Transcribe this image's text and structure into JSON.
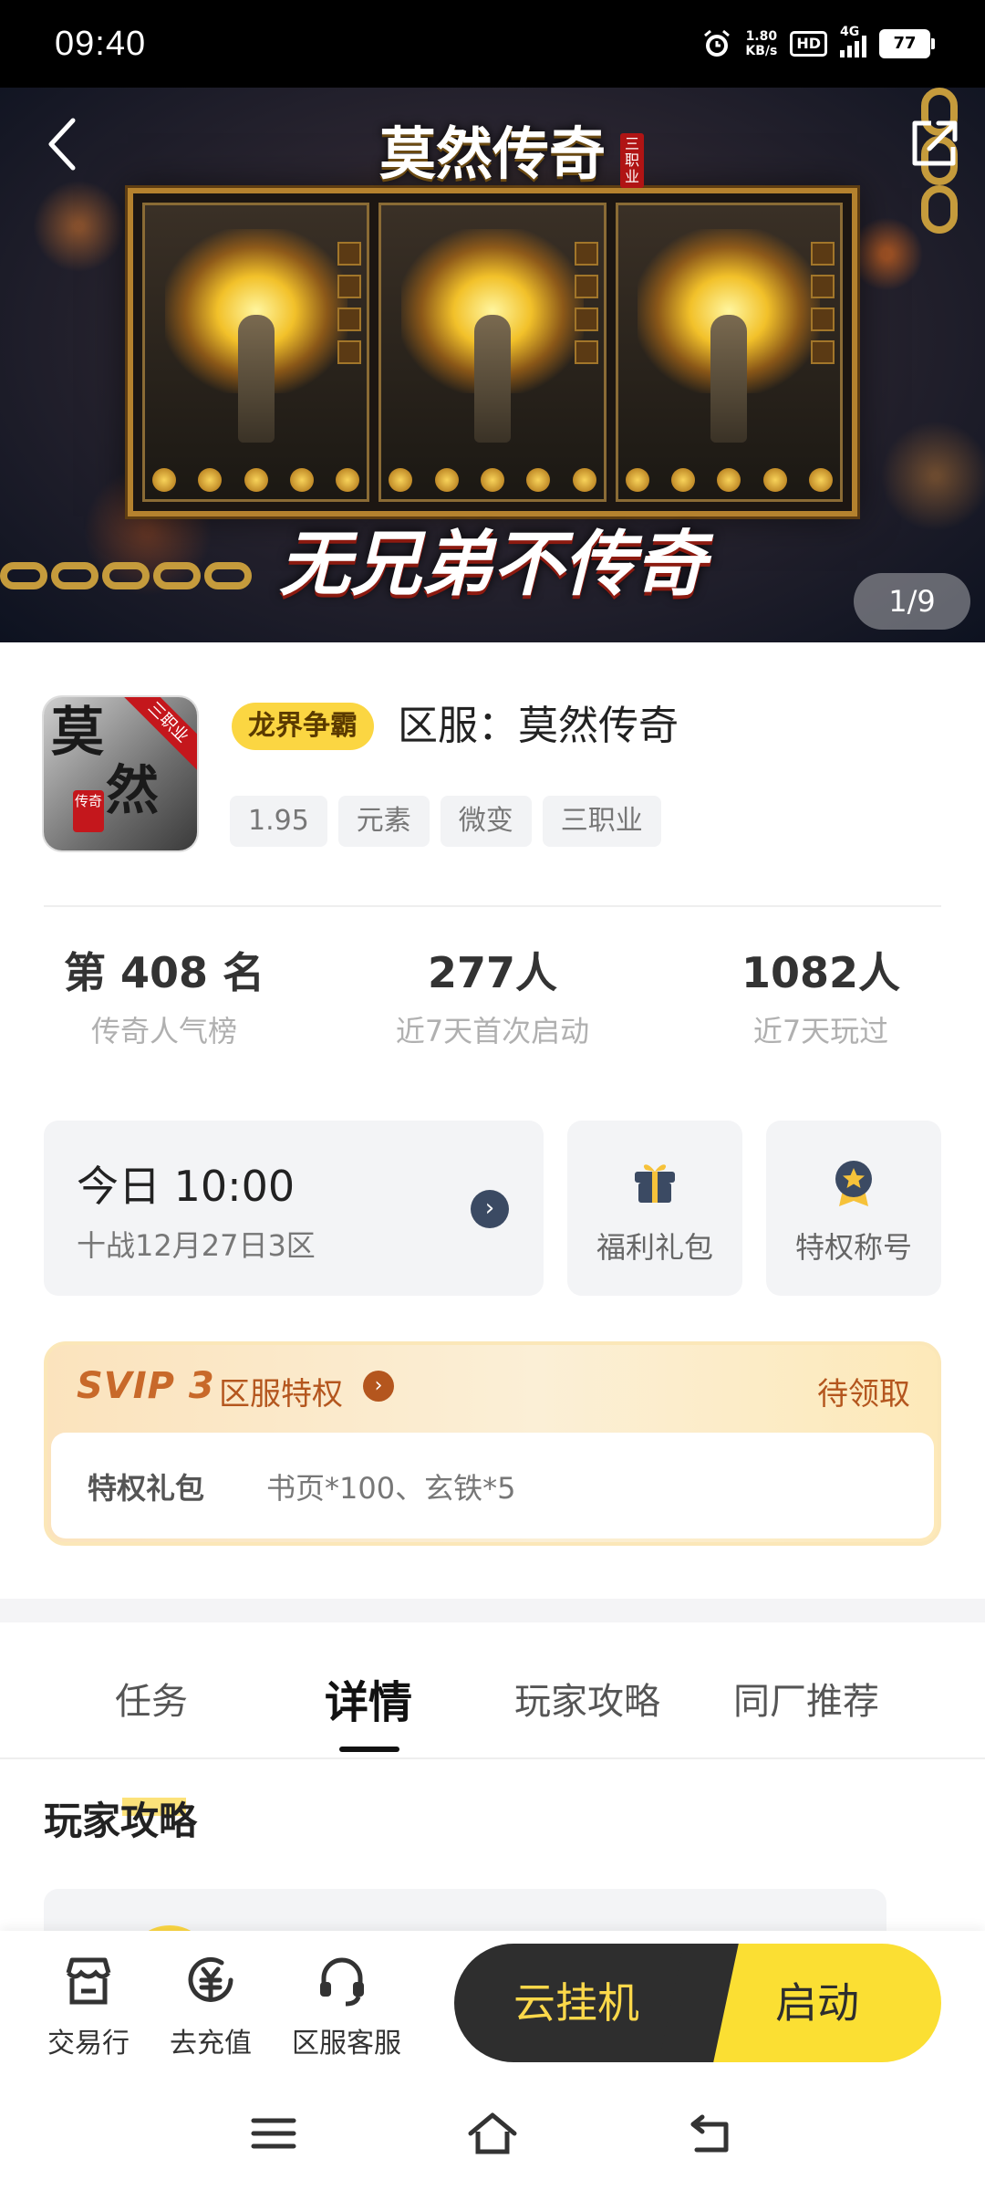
{
  "status_bar": {
    "time": "09:40",
    "net_speed_value": "1.80",
    "net_speed_unit": "KB/s",
    "hd_label": "HD",
    "network_type": "4G",
    "battery": "77",
    "icons": [
      "alarm-icon",
      "hd-icon",
      "signal-icon",
      "battery-icon"
    ]
  },
  "hero": {
    "title": "莫然传奇",
    "title_badge": "三职业",
    "slogan": "无兄弟不传奇",
    "page_indicator": "1/9",
    "icons": [
      "back-arrow-icon",
      "share-icon"
    ]
  },
  "game": {
    "icon_text_1": "莫",
    "icon_text_2": "然",
    "icon_ribbon": "三职业",
    "icon_stamp": "传奇",
    "badge": "龙界争霸",
    "title": "区服：莫然传奇",
    "tags": [
      "1.95",
      "元素",
      "微变",
      "三职业"
    ]
  },
  "stats": [
    {
      "value": "第 408 名",
      "label": "传奇人气榜"
    },
    {
      "value": "277人",
      "label": "近7天首次启动"
    },
    {
      "value": "1082人",
      "label": "近7天玩过"
    }
  ],
  "server_open": {
    "time": "今日 10:00",
    "server": "十战12月27日3区"
  },
  "quick_actions": [
    {
      "label": "福利礼包",
      "icon": "gift-box-icon"
    },
    {
      "label": "特权称号",
      "icon": "star-medal-icon"
    }
  ],
  "svip": {
    "logo": "SVIP 3",
    "name": "区服特权",
    "status": "待领取",
    "gift_key": "特权礼包",
    "gift_value": "书页*100、玄铁*5"
  },
  "tabs": [
    {
      "label": "任务",
      "active": false
    },
    {
      "label": "详情",
      "active": true
    },
    {
      "label": "玩家攻略",
      "active": false
    },
    {
      "label": "同厂推荐",
      "active": false
    }
  ],
  "section": {
    "title": "玩家攻略"
  },
  "bottom_bar": {
    "items": [
      {
        "label": "交易行",
        "icon": "shop-icon"
      },
      {
        "label": "去充值",
        "icon": "recharge-icon"
      },
      {
        "label": "区服客服",
        "icon": "headset-icon"
      }
    ],
    "cloud_button": "云挂机",
    "launch_button": "启动"
  },
  "colors": {
    "accent_yellow": "#fbdf33",
    "dark_button": "#2e2e2e",
    "svip_text": "#b4561e"
  }
}
